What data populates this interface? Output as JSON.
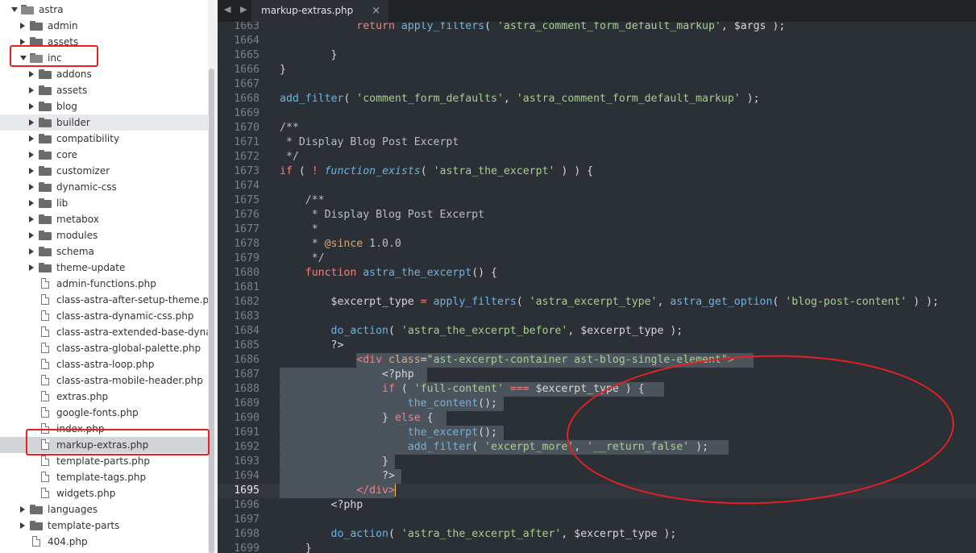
{
  "sidebar": {
    "items": [
      {
        "label": "astra",
        "type": "folder",
        "open": true,
        "depth": 0,
        "state": ""
      },
      {
        "label": "admin",
        "type": "folder",
        "open": false,
        "depth": 1,
        "state": ""
      },
      {
        "label": "assets",
        "type": "folder",
        "open": false,
        "depth": 1,
        "state": ""
      },
      {
        "label": "inc",
        "type": "folder",
        "open": true,
        "depth": 1,
        "state": ""
      },
      {
        "label": "addons",
        "type": "folder",
        "open": false,
        "depth": 2,
        "state": ""
      },
      {
        "label": "assets",
        "type": "folder",
        "open": false,
        "depth": 2,
        "state": ""
      },
      {
        "label": "blog",
        "type": "folder",
        "open": false,
        "depth": 2,
        "state": ""
      },
      {
        "label": "builder",
        "type": "folder",
        "open": false,
        "depth": 2,
        "state": "highlight"
      },
      {
        "label": "compatibility",
        "type": "folder",
        "open": false,
        "depth": 2,
        "state": ""
      },
      {
        "label": "core",
        "type": "folder",
        "open": false,
        "depth": 2,
        "state": ""
      },
      {
        "label": "customizer",
        "type": "folder",
        "open": false,
        "depth": 2,
        "state": ""
      },
      {
        "label": "dynamic-css",
        "type": "folder",
        "open": false,
        "depth": 2,
        "state": ""
      },
      {
        "label": "lib",
        "type": "folder",
        "open": false,
        "depth": 2,
        "state": ""
      },
      {
        "label": "metabox",
        "type": "folder",
        "open": false,
        "depth": 2,
        "state": ""
      },
      {
        "label": "modules",
        "type": "folder",
        "open": false,
        "depth": 2,
        "state": ""
      },
      {
        "label": "schema",
        "type": "folder",
        "open": false,
        "depth": 2,
        "state": ""
      },
      {
        "label": "theme-update",
        "type": "folder",
        "open": false,
        "depth": 2,
        "state": ""
      },
      {
        "label": "admin-functions.php",
        "type": "file",
        "depth": 2,
        "state": ""
      },
      {
        "label": "class-astra-after-setup-theme.php",
        "type": "file",
        "depth": 2,
        "state": ""
      },
      {
        "label": "class-astra-dynamic-css.php",
        "type": "file",
        "depth": 2,
        "state": ""
      },
      {
        "label": "class-astra-extended-base-dynamic",
        "type": "file",
        "depth": 2,
        "state": ""
      },
      {
        "label": "class-astra-global-palette.php",
        "type": "file",
        "depth": 2,
        "state": ""
      },
      {
        "label": "class-astra-loop.php",
        "type": "file",
        "depth": 2,
        "state": ""
      },
      {
        "label": "class-astra-mobile-header.php",
        "type": "file",
        "depth": 2,
        "state": ""
      },
      {
        "label": "extras.php",
        "type": "file",
        "depth": 2,
        "state": ""
      },
      {
        "label": "google-fonts.php",
        "type": "file",
        "depth": 2,
        "state": ""
      },
      {
        "label": "index.php",
        "type": "file",
        "depth": 2,
        "state": ""
      },
      {
        "label": "markup-extras.php",
        "type": "file",
        "depth": 2,
        "state": "selected"
      },
      {
        "label": "template-parts.php",
        "type": "file",
        "depth": 2,
        "state": ""
      },
      {
        "label": "template-tags.php",
        "type": "file",
        "depth": 2,
        "state": ""
      },
      {
        "label": "widgets.php",
        "type": "file",
        "depth": 2,
        "state": ""
      },
      {
        "label": "languages",
        "type": "folder",
        "open": false,
        "depth": 1,
        "state": ""
      },
      {
        "label": "template-parts",
        "type": "folder",
        "open": false,
        "depth": 1,
        "state": ""
      },
      {
        "label": "404.php",
        "type": "file",
        "depth": 1,
        "state": ""
      }
    ]
  },
  "editor": {
    "nav_arrows": "◀ ▶",
    "tab": {
      "label": "markup-extras.php",
      "close": "×"
    },
    "current_line": "1695",
    "lines": [
      {
        "n": "1663",
        "tokens": [
          [
            "guide",
            "            "
          ],
          [
            "k",
            "return "
          ],
          [
            "f",
            "apply_filters"
          ],
          [
            "p",
            "( "
          ],
          [
            "s",
            "'astra_comment_form_default_markup'"
          ],
          [
            "p",
            ", "
          ],
          [
            "v",
            "$args"
          ],
          [
            "p",
            " );"
          ]
        ]
      },
      {
        "n": "1664",
        "tokens": []
      },
      {
        "n": "1665",
        "tokens": [
          [
            "p",
            "        }"
          ]
        ]
      },
      {
        "n": "1666",
        "tokens": [
          [
            "p",
            "}"
          ]
        ]
      },
      {
        "n": "1667",
        "tokens": []
      },
      {
        "n": "1668",
        "tokens": [
          [
            "f",
            "add_filter"
          ],
          [
            "p",
            "( "
          ],
          [
            "s",
            "'comment_form_defaults'"
          ],
          [
            "p",
            ", "
          ],
          [
            "s",
            "'astra_comment_form_default_markup'"
          ],
          [
            "p",
            " );"
          ]
        ]
      },
      {
        "n": "1669",
        "tokens": []
      },
      {
        "n": "1670",
        "tokens": [
          [
            "c",
            "/**"
          ]
        ]
      },
      {
        "n": "1671",
        "tokens": [
          [
            "c",
            " * Display Blog Post Excerpt"
          ]
        ]
      },
      {
        "n": "1672",
        "tokens": [
          [
            "c",
            " */"
          ]
        ]
      },
      {
        "n": "1673",
        "tokens": [
          [
            "k",
            "if"
          ],
          [
            "p",
            " ( "
          ],
          [
            "k",
            "! "
          ],
          [
            "fi",
            "function_exists"
          ],
          [
            "p",
            "( "
          ],
          [
            "s",
            "'astra_the_excerpt'"
          ],
          [
            "p",
            " ) ) {"
          ]
        ]
      },
      {
        "n": "1674",
        "tokens": []
      },
      {
        "n": "1675",
        "tokens": [
          [
            "c",
            "    /**"
          ]
        ]
      },
      {
        "n": "1676",
        "tokens": [
          [
            "c",
            "     * Display Blog Post Excerpt"
          ]
        ]
      },
      {
        "n": "1677",
        "tokens": [
          [
            "c",
            "     *"
          ]
        ]
      },
      {
        "n": "1678",
        "tokens": [
          [
            "c",
            "     * "
          ],
          [
            "a",
            "@since"
          ],
          [
            "c",
            " 1.0.0"
          ]
        ]
      },
      {
        "n": "1679",
        "tokens": [
          [
            "c",
            "     */"
          ]
        ]
      },
      {
        "n": "1680",
        "tokens": [
          [
            "k",
            "    function "
          ],
          [
            "f",
            "astra_the_excerpt"
          ],
          [
            "p",
            "() {"
          ]
        ]
      },
      {
        "n": "1681",
        "tokens": []
      },
      {
        "n": "1682",
        "tokens": [
          [
            "v",
            "        $excerpt_type"
          ],
          [
            "k",
            " = "
          ],
          [
            "f",
            "apply_filters"
          ],
          [
            "p",
            "( "
          ],
          [
            "s",
            "'astra_excerpt_type'"
          ],
          [
            "p",
            ", "
          ],
          [
            "f",
            "astra_get_option"
          ],
          [
            "p",
            "( "
          ],
          [
            "s",
            "'blog-post-content'"
          ],
          [
            "p",
            " ) );"
          ]
        ]
      },
      {
        "n": "1683",
        "tokens": []
      },
      {
        "n": "1684",
        "tokens": [
          [
            "f",
            "        do_action"
          ],
          [
            "p",
            "( "
          ],
          [
            "s",
            "'astra_the_excerpt_before'"
          ],
          [
            "p",
            ", "
          ],
          [
            "v",
            "$excerpt_type"
          ],
          [
            "p",
            " );"
          ]
        ]
      },
      {
        "n": "1685",
        "tokens": [
          [
            "p",
            "        ?>"
          ]
        ]
      },
      {
        "n": "1686",
        "tokens": [
          [
            "guide",
            "            "
          ],
          [
            "t",
            "<div "
          ],
          [
            "a",
            "class"
          ],
          [
            "p",
            "="
          ],
          [
            "s",
            "\"ast-excerpt-container ast-blog-single-element\""
          ],
          [
            "t",
            ">"
          ]
        ]
      },
      {
        "n": "1687",
        "tokens": [
          [
            "guide",
            "                "
          ],
          [
            "p",
            "<?php"
          ]
        ]
      },
      {
        "n": "1688",
        "tokens": [
          [
            "guide",
            "                "
          ],
          [
            "k",
            "if"
          ],
          [
            "p",
            " ( "
          ],
          [
            "s",
            "'full-content'"
          ],
          [
            "k",
            " === "
          ],
          [
            "v",
            "$excerpt_type"
          ],
          [
            "p",
            " ) {"
          ]
        ]
      },
      {
        "n": "1689",
        "tokens": [
          [
            "guide",
            "                    "
          ],
          [
            "f",
            "the_content"
          ],
          [
            "p",
            "();"
          ]
        ]
      },
      {
        "n": "1690",
        "tokens": [
          [
            "guide",
            "                "
          ],
          [
            "p",
            "} "
          ],
          [
            "k",
            "else"
          ],
          [
            "p",
            " {"
          ]
        ]
      },
      {
        "n": "1691",
        "tokens": [
          [
            "guide",
            "                    "
          ],
          [
            "f",
            "the_excerpt"
          ],
          [
            "p",
            "();"
          ]
        ]
      },
      {
        "n": "1692",
        "tokens": [
          [
            "guide",
            "                    "
          ],
          [
            "f",
            "add_filter"
          ],
          [
            "p",
            "( "
          ],
          [
            "s",
            "'excerpt_more'"
          ],
          [
            "p",
            ", "
          ],
          [
            "s",
            "'__return_false'"
          ],
          [
            "p",
            " );"
          ]
        ]
      },
      {
        "n": "1693",
        "tokens": [
          [
            "guide",
            "                "
          ],
          [
            "p",
            "}"
          ]
        ]
      },
      {
        "n": "1694",
        "tokens": [
          [
            "guide",
            "                "
          ],
          [
            "p",
            "?>"
          ]
        ]
      },
      {
        "n": "1695",
        "tokens": [
          [
            "guide",
            "            "
          ],
          [
            "t",
            "</div>"
          ]
        ]
      },
      {
        "n": "1696",
        "tokens": [
          [
            "p",
            "        <?php"
          ]
        ]
      },
      {
        "n": "1697",
        "tokens": []
      },
      {
        "n": "1698",
        "tokens": [
          [
            "f",
            "        do_action"
          ],
          [
            "p",
            "( "
          ],
          [
            "s",
            "'astra_the_excerpt_after'"
          ],
          [
            "p",
            ", "
          ],
          [
            "v",
            "$excerpt_type"
          ],
          [
            "p",
            " );"
          ]
        ]
      },
      {
        "n": "1699",
        "tokens": [
          [
            "p",
            "    }"
          ]
        ]
      }
    ]
  },
  "colors": {
    "annotation": "#e8201f",
    "editor_bg": "#2b3036",
    "selection": "#4b545c"
  }
}
